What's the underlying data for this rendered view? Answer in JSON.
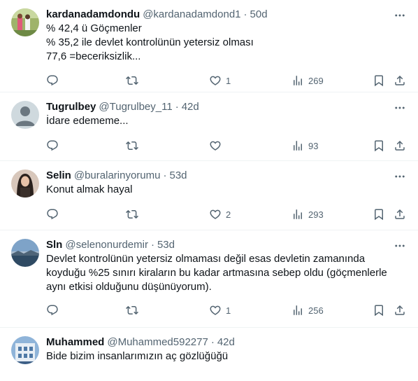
{
  "tweets": [
    {
      "name": "kardanadamdondu",
      "handle": "@kardanadamdond1",
      "time": "50d",
      "text": "% 42,4 ü Göçmenler\n% 35,2 ile devlet kontrolünün yetersiz olması\n77,6 =beceriksizlik...",
      "replies": "",
      "retweets": "",
      "likes": "1",
      "views": "269",
      "avatar": "photo-children"
    },
    {
      "name": "Tugrulbey",
      "handle": "@Tugrulbey_11",
      "time": "42d",
      "text": "İdare edememe...",
      "replies": "",
      "retweets": "",
      "likes": "",
      "views": "93",
      "avatar": "default-avatar"
    },
    {
      "name": "Selin",
      "handle": "@buralarinyorumu",
      "time": "53d",
      "text": "Konut almak hayal",
      "replies": "",
      "retweets": "",
      "likes": "2",
      "views": "293",
      "avatar": "photo-woman"
    },
    {
      "name": "Sln",
      "handle": "@selenonurdemir",
      "time": "53d",
      "text": "Devlet kontrolünün yetersiz olmaması değil esas devletin zamanında koyduğu %25 sınırı kiraların bu kadar artmasına sebep oldu (göçmenlerle aynı etkisi olduğunu düşünüyorum).",
      "replies": "",
      "retweets": "",
      "likes": "1",
      "views": "256",
      "avatar": "photo-landscape"
    },
    {
      "name": "Muhammed",
      "handle": "@Muhammed592277",
      "time": "42d",
      "text": "Bide bizim insanlarımızın aç gözlüğüğü",
      "replies": "",
      "retweets": "",
      "likes": "",
      "views": "",
      "avatar": "photo-building"
    }
  ],
  "icons": {
    "reply": "reply-icon",
    "retweet": "retweet-icon",
    "like": "heart-icon",
    "views": "analytics-icon",
    "bookmark": "bookmark-icon",
    "share": "share-icon",
    "more": "more-icon"
  },
  "colors": {
    "text": "#0f1419",
    "secondary": "#536471",
    "border": "#eff3f4"
  }
}
